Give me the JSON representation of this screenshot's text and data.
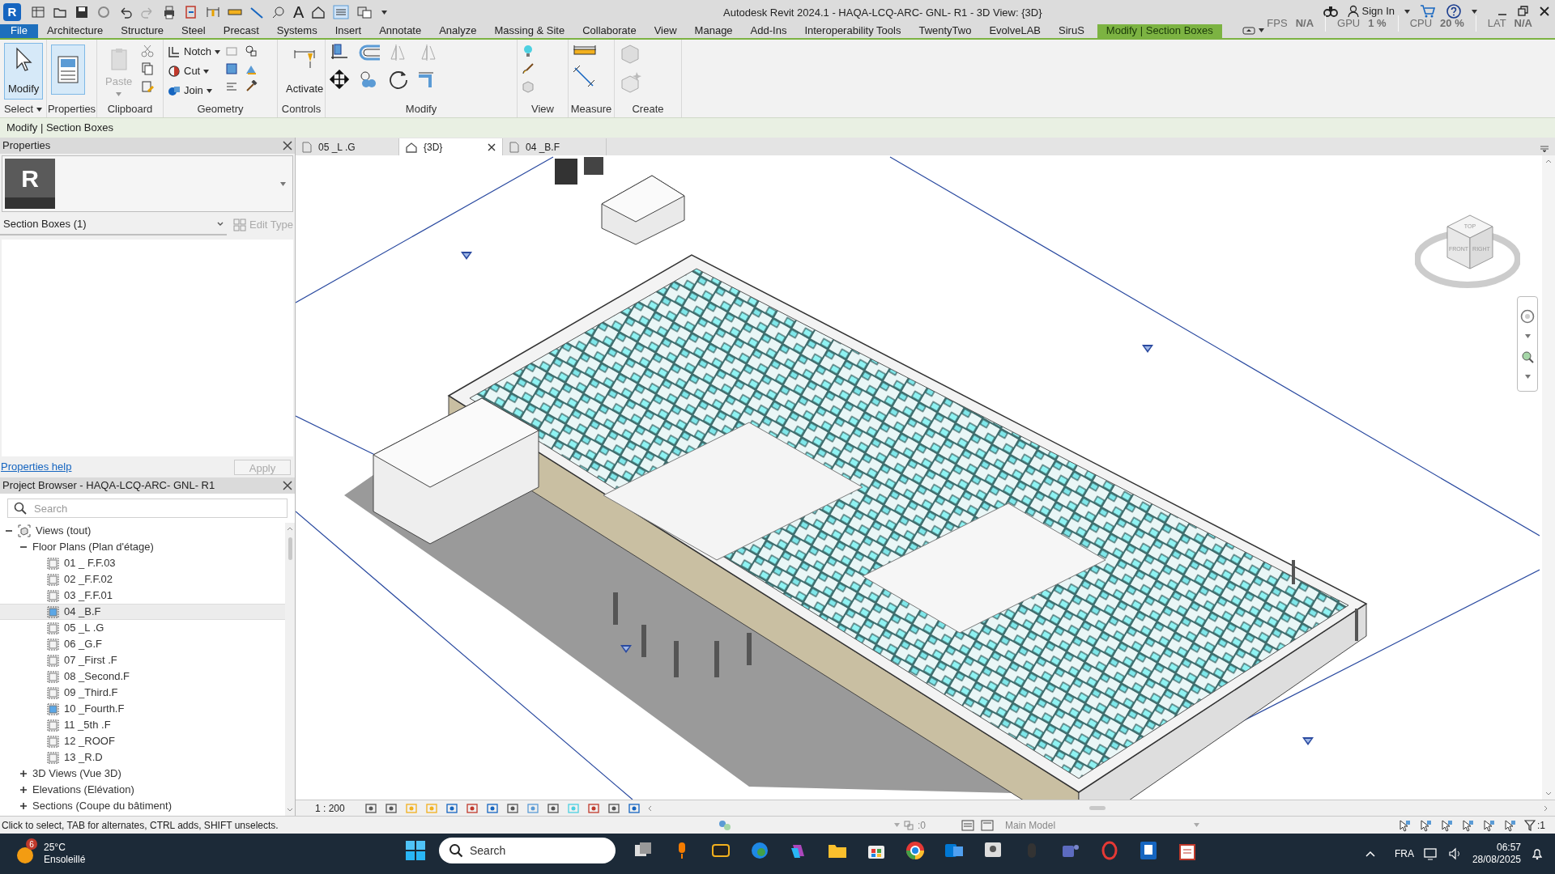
{
  "window": {
    "app_letter": "R",
    "title": "Autodesk Revit 2024.1 - HAQA-LCQ-ARC- GNL- R1 - 3D View: {3D}",
    "text_tool": "A",
    "sign_in": "Sign In"
  },
  "performance": [
    {
      "label": "FPS",
      "value": "N/A"
    },
    {
      "label": "GPU",
      "value": "1 %"
    },
    {
      "label": "CPU",
      "value": "20 %"
    },
    {
      "label": "LAT",
      "value": "N/A"
    }
  ],
  "ribbon_tabs": [
    {
      "label": "File",
      "kind": "file",
      "selected": false
    },
    {
      "label": "Architecture",
      "kind": "tab",
      "selected": false
    },
    {
      "label": "Structure",
      "kind": "tab",
      "selected": false
    },
    {
      "label": "Steel",
      "kind": "tab",
      "selected": false
    },
    {
      "label": "Precast",
      "kind": "tab",
      "selected": false
    },
    {
      "label": "Systems",
      "kind": "tab",
      "selected": false
    },
    {
      "label": "Insert",
      "kind": "tab",
      "selected": false
    },
    {
      "label": "Annotate",
      "kind": "tab",
      "selected": false
    },
    {
      "label": "Analyze",
      "kind": "tab",
      "selected": false
    },
    {
      "label": "Massing & Site",
      "kind": "tab",
      "selected": false
    },
    {
      "label": "Collaborate",
      "kind": "tab",
      "selected": false
    },
    {
      "label": "View",
      "kind": "tab",
      "selected": false
    },
    {
      "label": "Manage",
      "kind": "tab",
      "selected": false
    },
    {
      "label": "Add-Ins",
      "kind": "tab",
      "selected": false
    },
    {
      "label": "Interoperability Tools",
      "kind": "tab",
      "selected": false
    },
    {
      "label": "TwentyTwo",
      "kind": "tab",
      "selected": false
    },
    {
      "label": "EvolveLAB",
      "kind": "tab",
      "selected": false
    },
    {
      "label": "SiruS",
      "kind": "tab",
      "selected": false
    },
    {
      "label": "Modify | Section Boxes",
      "kind": "contextual",
      "selected": true
    }
  ],
  "ribbon_panels": [
    {
      "label": "Select",
      "dropdown": true,
      "tools": [
        {
          "kind": "large",
          "label": "Modify",
          "selected": true,
          "disabled": false
        }
      ]
    },
    {
      "label": "Properties",
      "dropdown": false,
      "tools": [
        {
          "kind": "toggle",
          "on": true
        }
      ]
    },
    {
      "label": "Clipboard",
      "dropdown": false,
      "tools": [
        {
          "kind": "large",
          "label": "Paste",
          "selected": false,
          "disabled": true
        }
      ]
    },
    {
      "label": "Geometry",
      "dropdown": false,
      "tools": [
        {
          "kind": "small",
          "label": "Notch",
          "selected": false,
          "disabled": false
        },
        {
          "kind": "small",
          "label": "Cut",
          "selected": false,
          "disabled": false
        },
        {
          "kind": "small",
          "label": "Join",
          "selected": false,
          "disabled": false
        }
      ]
    },
    {
      "label": "Controls",
      "dropdown": false,
      "tools": [
        {
          "kind": "large",
          "label": "Activate",
          "selected": false,
          "disabled": false
        }
      ]
    },
    {
      "label": "Modify",
      "dropdown": false
    },
    {
      "label": "View",
      "dropdown": false
    },
    {
      "label": "Measure",
      "dropdown": false
    },
    {
      "label": "Create",
      "dropdown": false
    }
  ],
  "options_bar": "Modify | Section Boxes",
  "properties": {
    "title": "Properties",
    "logo_letter": "R",
    "type_selector": "Section Boxes (1)",
    "edit_type": "Edit Type",
    "edit_type_disabled": true,
    "help_link": "Properties help",
    "apply": "Apply",
    "apply_disabled": true
  },
  "project_browser": {
    "title": "Project Browser - HAQA-LCQ-ARC- GNL- R1",
    "search_placeholder": "Search",
    "tree": [
      {
        "label": "Views (tout)",
        "expanded": true,
        "selected": false,
        "children": [
          {
            "label": "Floor Plans (Plan d'étage)",
            "expanded": true,
            "selected": false,
            "children": [
              {
                "label": "01 _ F.F.03",
                "open": false,
                "selected": false
              },
              {
                "label": "02 _F.F.02",
                "open": false,
                "selected": false
              },
              {
                "label": "03 _F.F.01",
                "open": false,
                "selected": false
              },
              {
                "label": "04 _B.F",
                "open": true,
                "selected": true
              },
              {
                "label": "05 _L .G",
                "open": false,
                "selected": false
              },
              {
                "label": "06 _G.F",
                "open": false,
                "selected": false
              },
              {
                "label": "07 _First .F",
                "open": false,
                "selected": false
              },
              {
                "label": "08 _Second.F",
                "open": false,
                "selected": false
              },
              {
                "label": "09 _Third.F",
                "open": false,
                "selected": false
              },
              {
                "label": "10 _Fourth.F",
                "open": true,
                "selected": false
              },
              {
                "label": "11 _5th .F",
                "open": false,
                "selected": false
              },
              {
                "label": "12 _ROOF",
                "open": false,
                "selected": false
              },
              {
                "label": "13 _R.D",
                "open": false,
                "selected": false
              }
            ]
          },
          {
            "label": "3D Views (Vue 3D)",
            "kind": "group",
            "expanded": false,
            "selected": false
          },
          {
            "label": "Elevations (Elévation)",
            "kind": "group",
            "expanded": false,
            "selected": false
          },
          {
            "label": "Sections (Coupe du bâtiment)",
            "kind": "group",
            "expanded": false,
            "selected": false
          }
        ]
      }
    ]
  },
  "view_tabs": [
    {
      "label": "05 _L .G",
      "kind": "plan",
      "selected": false
    },
    {
      "label": "{3D}",
      "kind": "model",
      "selected": true
    },
    {
      "label": "04 _B.F",
      "kind": "plan",
      "selected": false
    }
  ],
  "viewcube": {
    "faces": [
      "TOP",
      "FRONT",
      "RIGHT"
    ]
  },
  "view_control": {
    "scale": "1 : 200"
  },
  "status_bar": {
    "hint": "Click to select, TAB for alternates, CTRL adds, SHIFT unselects.",
    "worksets": ":0",
    "model": "Main Model",
    "filter": ":1"
  },
  "taskbar": {
    "temp": "25°C",
    "condition": "Ensoleillé",
    "badge": "6",
    "search_placeholder": "Search",
    "language": "FRA",
    "time": "06:57",
    "date": "28/08/2025"
  }
}
